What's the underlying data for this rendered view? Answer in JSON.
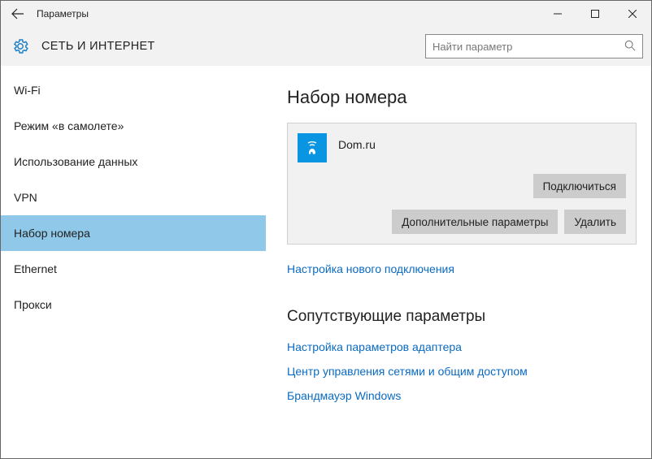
{
  "titlebar": {
    "title": "Параметры"
  },
  "header": {
    "section_title": "СЕТЬ И ИНТЕРНЕТ",
    "search_placeholder": "Найти параметр"
  },
  "sidebar": {
    "items": [
      {
        "label": "Wi-Fi",
        "selected": false
      },
      {
        "label": "Режим «в самолете»",
        "selected": false
      },
      {
        "label": "Использование данных",
        "selected": false
      },
      {
        "label": "VPN",
        "selected": false
      },
      {
        "label": "Набор номера",
        "selected": true
      },
      {
        "label": "Ethernet",
        "selected": false
      },
      {
        "label": "Прокси",
        "selected": false
      }
    ]
  },
  "main": {
    "heading": "Набор номера",
    "connection": {
      "name": "Dom.ru",
      "connect_label": "Подключиться",
      "advanced_label": "Дополнительные параметры",
      "delete_label": "Удалить"
    },
    "new_connection_link": "Настройка нового подключения",
    "related": {
      "heading": "Сопутствующие параметры",
      "links": [
        "Настройка параметров адаптера",
        "Центр управления сетями и общим доступом",
        "Брандмауэр Windows"
      ]
    }
  }
}
